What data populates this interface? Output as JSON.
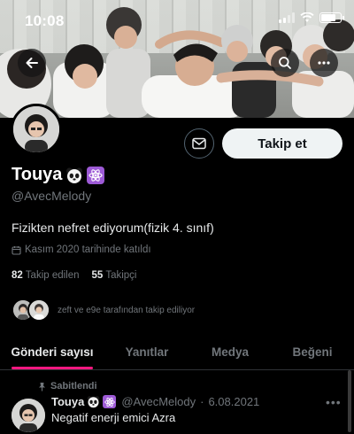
{
  "status_bar": {
    "time": "10:08",
    "battery_level": 0.75
  },
  "banner": {
    "description_icon": "banner-photo"
  },
  "profile": {
    "display_name": "Touya",
    "handle": "@AvecMelody",
    "bio": "Fizikten nefret ediyorum(fizik 4. sınıf)",
    "joined": "Kasım 2020 tarihinde katıldı",
    "following_count": "82",
    "following_label": "Takip edilen",
    "followers_count": "55",
    "followers_label": "Takipçi",
    "followed_by_text": "zeft ve e9e tarafından takip ediliyor",
    "emoji_1": "🐼",
    "emoji_2": "⚛"
  },
  "actions": {
    "follow_label": "Takip et"
  },
  "tabs": [
    {
      "label": "Gönderi sayısı",
      "active": true
    },
    {
      "label": "Yanıtlar",
      "active": false
    },
    {
      "label": "Medya",
      "active": false
    },
    {
      "label": "Beğeni",
      "active": false
    }
  ],
  "post": {
    "pinned_label": "Sabitlendi",
    "name": "Touya",
    "handle": "@AvecMelody",
    "date": "6.08.2021",
    "separator": "·",
    "text": "Negatif enerji emici Azra",
    "more": "•••"
  },
  "colors": {
    "accent": "#f91880",
    "badge": "#9d5ad6",
    "muted": "#71767b"
  }
}
